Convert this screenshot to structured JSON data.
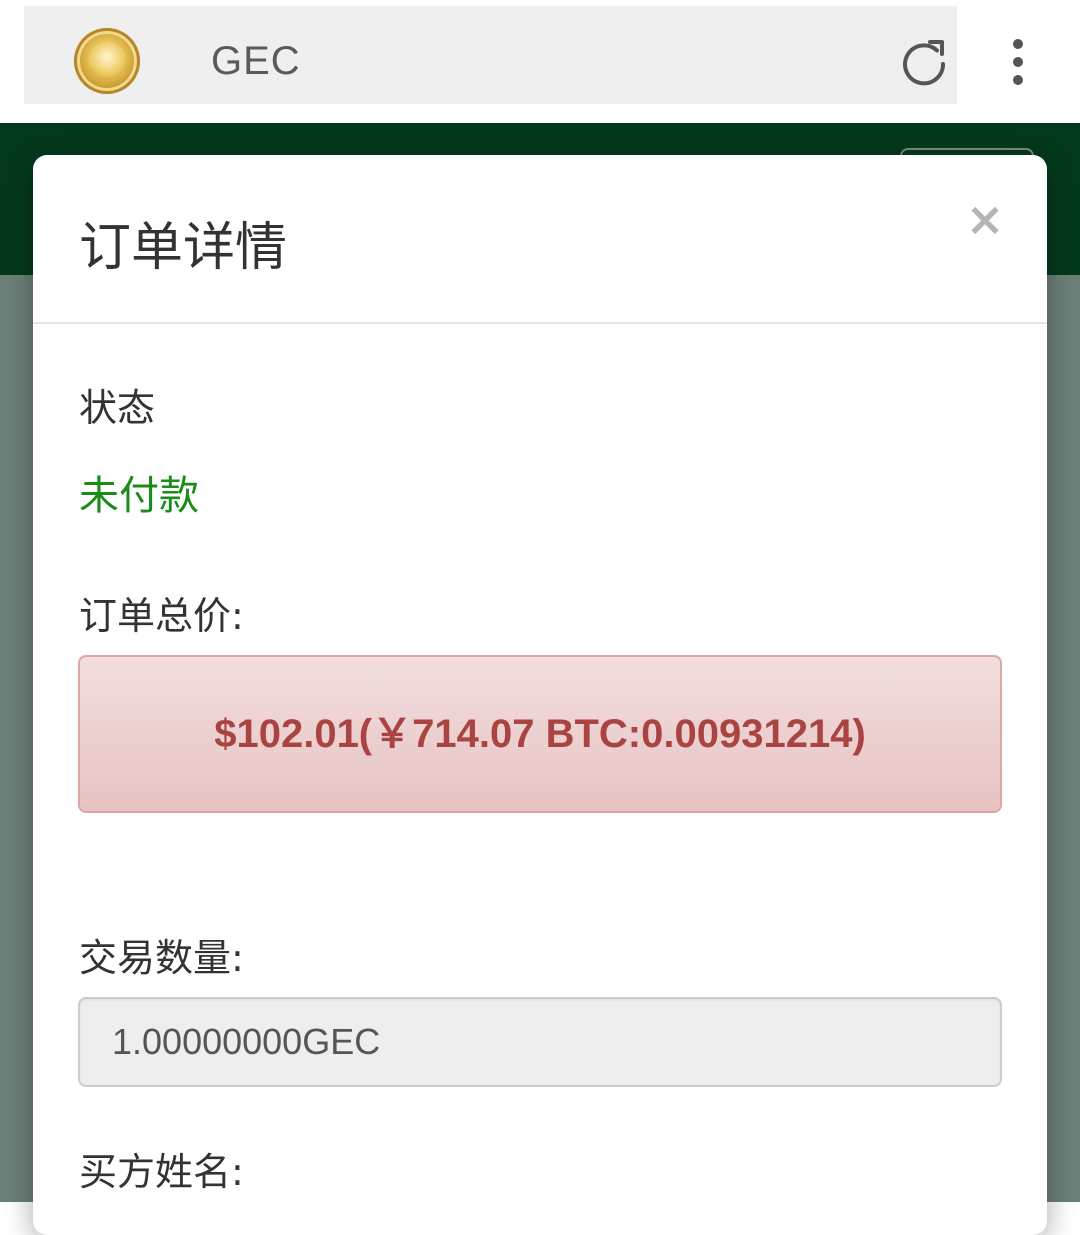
{
  "browser": {
    "site_title": "GEC",
    "reload_icon": "reload-icon",
    "more_icon": "more-vert-icon",
    "logo_icon": "gec-logo"
  },
  "modal": {
    "title": "订单详情",
    "close_label": "×",
    "status_label": "状态",
    "status_value": "未付款",
    "total_label": "订单总价:",
    "total_value": "$102.01(￥714.07 BTC:0.00931214)",
    "quantity_label": "交易数量:",
    "quantity_value": "1.00000000GEC",
    "buyer_label": "买方姓名:"
  },
  "colors": {
    "header_green": "#043a1c",
    "status_green": "#1a8c1a",
    "price_red": "#a94442",
    "price_bg": "#f2dede"
  }
}
